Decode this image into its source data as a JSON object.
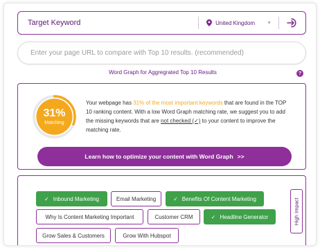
{
  "keyword_bar": {
    "placeholder": "Target Keyword",
    "location_icon": "map-pin-icon",
    "country": "United Kingdom",
    "dropdown_icon": "caret-down-icon",
    "submit_icon": "arrow-into-box-icon"
  },
  "url_bar": {
    "placeholder": "Enter your page URL to compare with Top 10 results. (recommended)"
  },
  "graph_title": "Word Graph for Aggregrated Top 10 Results",
  "help_icon": "question-mark-icon",
  "help_glyph": "?",
  "report": {
    "matching_percent": "31%",
    "matching_value": 0.31,
    "matching_label": "Matching",
    "text_before": "Your webpage has ",
    "text_highlight": "31% of the most important keywords",
    "text_middle": " that are found in the TOP 10 ranking content. With a low Word Graph matching rate, we suggest you to add the missing keywords that are ",
    "text_underline": "not checked (✓)",
    "text_after": " to your content to improve the matching rate.",
    "cta_label": "Learn how to optimize your content with Word Graph",
    "cta_arrows": ">>"
  },
  "tags": [
    {
      "label": "Inbound Marketing",
      "checked": true
    },
    {
      "label": "Email Marketing",
      "checked": false
    },
    {
      "label": "Benefits Of Content Marketing",
      "checked": true
    },
    {
      "label": "Why Is Content Marketing Important",
      "checked": false
    },
    {
      "label": "Customer CRM",
      "checked": false
    },
    {
      "label": "Headline Generator",
      "checked": true
    },
    {
      "label": "Grow Sales & Customers",
      "checked": false
    },
    {
      "label": "Grow With Hubspot",
      "checked": false
    }
  ],
  "check_glyph": "✓",
  "impact_tab": "High Impact",
  "colors": {
    "brand_purple": "#8e2f9a",
    "accent_orange": "#f4a81d",
    "tag_green": "#3fa14a"
  }
}
